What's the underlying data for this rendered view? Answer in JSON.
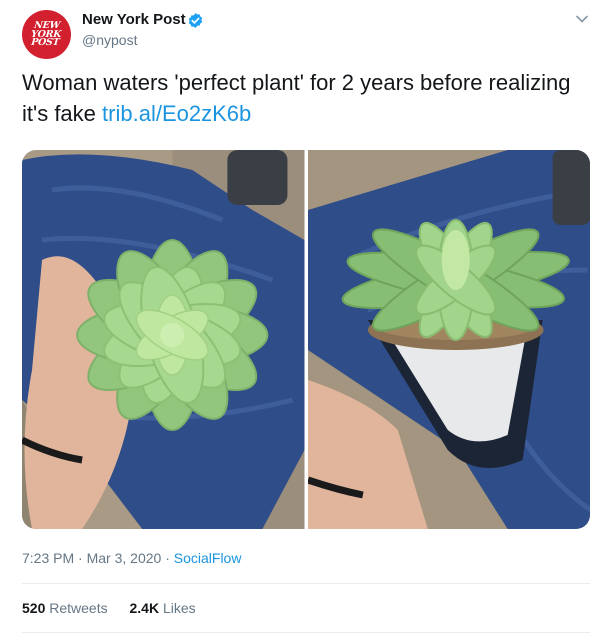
{
  "author": {
    "name": "New York Post",
    "handle": "@nypost",
    "avatar_lines": [
      "NEW",
      "YORK",
      "POST"
    ]
  },
  "tweet": {
    "text": "Woman waters 'perfect plant' for 2 years before realizing it's fake",
    "link_text": "trib.al/Eo2zK6b",
    "time": "7:23 PM",
    "date": "Mar 3, 2020",
    "source": "SocialFlow",
    "separator": "·"
  },
  "stats": {
    "retweets_count": "520",
    "retweets_label": "Retweets",
    "likes_count": "2.4K",
    "likes_label": "Likes"
  },
  "colors": {
    "brand_red": "#d2202e",
    "link_blue": "#1b95e0",
    "muted_gray": "#657786",
    "verified_blue": "#1da1f2"
  },
  "icons": {
    "verified": "verified-badge-icon",
    "caret": "chevron-down-icon"
  }
}
